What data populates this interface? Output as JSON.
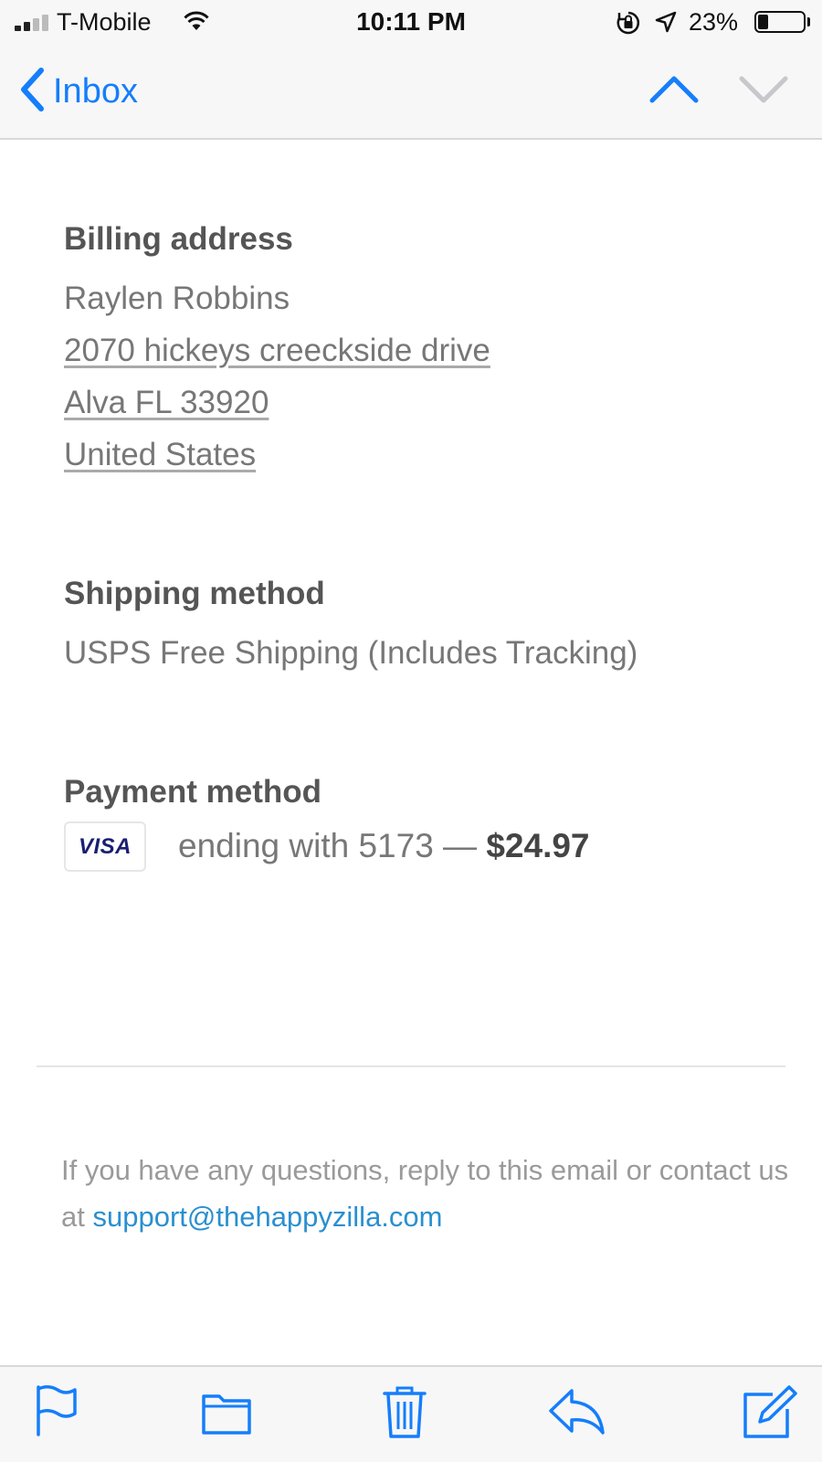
{
  "status_bar": {
    "carrier": "T-Mobile",
    "time": "10:11 PM",
    "battery_percent": "23%",
    "battery_level": 0.23,
    "icons": [
      "signal-icon",
      "wifi-icon",
      "orientation-lock-icon",
      "location-icon",
      "battery-icon"
    ]
  },
  "nav": {
    "back_label": "Inbox",
    "up_icon": "chevron-up-icon",
    "down_icon": "chevron-down-icon",
    "accent": "#157efb"
  },
  "billing": {
    "title": "Billing address",
    "name": "Raylen Robbins",
    "street": "2070 hickeys creeckside drive",
    "city": "Alva FL 33920",
    "country": "United States"
  },
  "shipping": {
    "title": "Shipping method",
    "method": "USPS Free Shipping (Includes Tracking)"
  },
  "payment": {
    "title": "Payment method",
    "card_brand": "VISA",
    "ending_text": "ending with 5173 —",
    "amount": "$24.97"
  },
  "footer": {
    "text": "If you have any questions, reply to this email or contact us at",
    "email": "support@thehappyzilla.com"
  },
  "toolbar": {
    "icons": [
      "flag-icon",
      "folder-icon",
      "trash-icon",
      "reply-icon",
      "compose-icon"
    ]
  }
}
